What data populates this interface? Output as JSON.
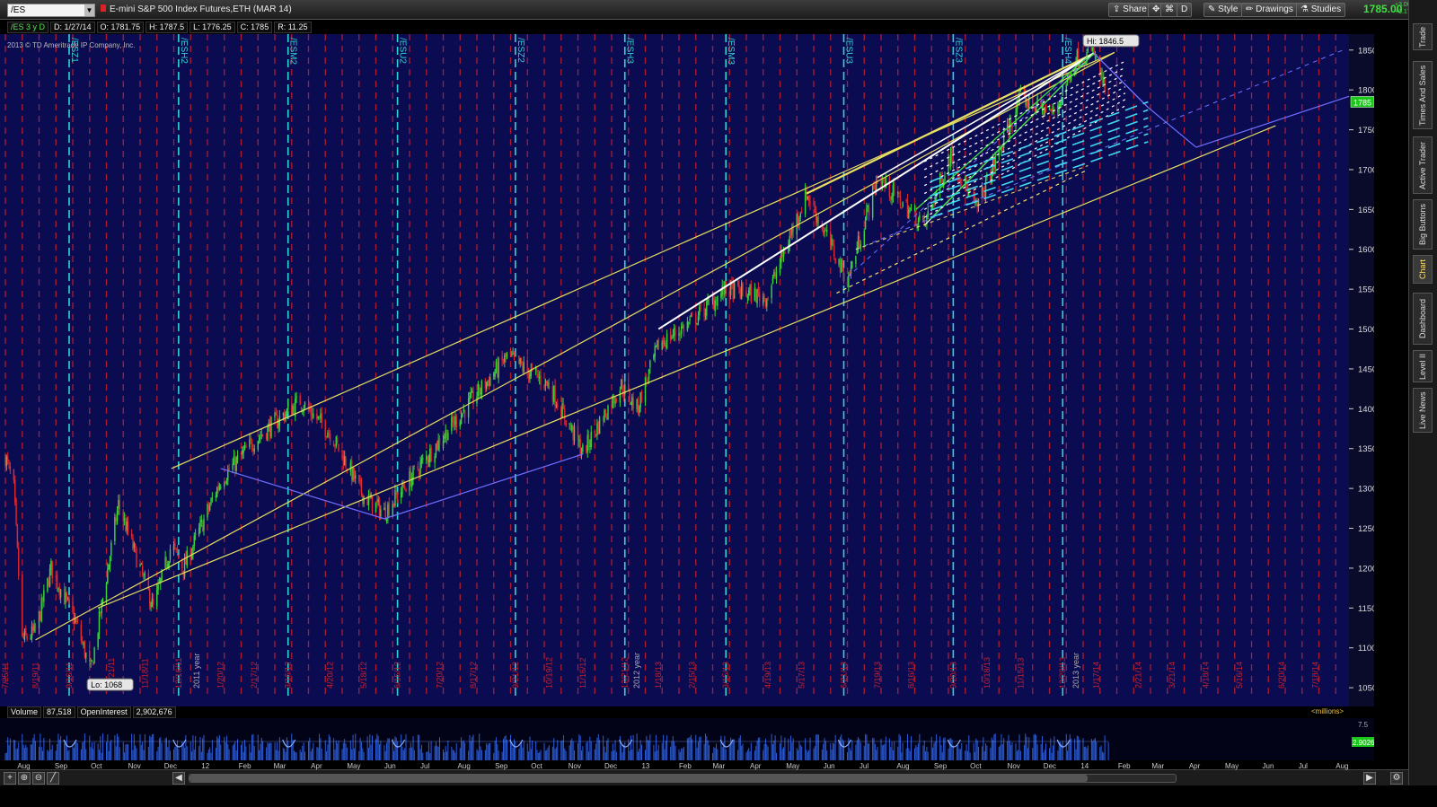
{
  "toolbar": {
    "symbol": "/ES",
    "description": "E-mini S&P 500 Index Futures,ETH (MAR 14)",
    "share_label": "Share",
    "style_label": "Style",
    "drawings_label": "Drawings",
    "studies_label": "Studies",
    "d_label": "D",
    "last_price": "1785.00",
    "change_up": "+3.00",
    "change_pct": "+0.17%"
  },
  "sidebar": {
    "tabs": [
      "Trade",
      "Times And Sales",
      "Active Trader",
      "Big Buttons",
      "Chart",
      "Dashboard",
      "Level II",
      "Live News"
    ],
    "active": "Chart"
  },
  "infobar": {
    "sym": "/ES 3 y D",
    "date": "D: 1/27/14",
    "open": "O: 1781.75",
    "high": "H: 1787.5",
    "low": "L: 1776.25",
    "close": "C: 1785",
    "range": "R: 11.25"
  },
  "copyright": "2013 © TD Ameritrade IP Company, Inc.",
  "volume_header": {
    "vol_label": "Volume",
    "vol_value": "87,518",
    "oi_label": "OpenInterest",
    "oi_value": "2,902,676",
    "units": "<millions>"
  },
  "colors": {
    "background": "#0b0b52",
    "up": "#3ad63a",
    "down": "#e0282f",
    "channel": "#e8e060",
    "trend": "#7070ff",
    "white_line": "#ffffff",
    "cyan": "#40d8f0",
    "expiry_line": "#31d4d4",
    "red_grid": "#c8202c",
    "price_label_bg": "#19c819"
  },
  "icons": [
    "plus-icon",
    "zoom-in-icon",
    "zoom-out-icon",
    "pen-icon",
    "arrow-left-icon",
    "arrow-right-icon",
    "pencil-icon",
    "gear-icon"
  ],
  "chart_data": {
    "type": "candlestick",
    "title": "/ES 3 y D",
    "ylim": [
      1040,
      1870
    ],
    "y_ticks": [
      1050,
      1100,
      1150,
      1200,
      1250,
      1300,
      1350,
      1400,
      1450,
      1500,
      1550,
      1600,
      1650,
      1700,
      1750,
      1800,
      1850
    ],
    "last_price_label": "1785",
    "hi_label": "Hi: 1846.5",
    "lo_label": "Lo: 1068",
    "x_month_labels": [
      "Aug",
      "Sep",
      "Oct",
      "Nov",
      "Dec",
      "12",
      "Feb",
      "Mar",
      "Apr",
      "May",
      "Jun",
      "Jul",
      "Aug",
      "Sep",
      "Oct",
      "Nov",
      "Dec",
      "13",
      "Feb",
      "Mar",
      "Apr",
      "May",
      "Jun",
      "Jul",
      "Aug",
      "Sep",
      "Oct",
      "Nov",
      "Dec",
      "14",
      "Feb",
      "Mar",
      "Apr",
      "May",
      "Jun",
      "Jul",
      "Aug"
    ],
    "expiry_labels": [
      "/ESZ1",
      "/ESH2",
      "/ESM2",
      "/ESU2",
      "/ESZ2",
      "/ESH3",
      "/ESM3",
      "/ESU3",
      "/ESZ3",
      "/ESH4"
    ],
    "date_labels": [
      "7/25/11",
      "8/19/11",
      "9/16/11",
      "10/21/11",
      "11/18/11",
      "12/16/11",
      "2011 year",
      "1/20/12",
      "2/17/12",
      "3/16/12",
      "4/20/12",
      "5/18/12",
      "6/15/12",
      "7/20/12",
      "8/17/12",
      "9/21/12",
      "10/19/12",
      "11/16/12",
      "12/21/12",
      "2012 year",
      "1/18/13",
      "2/15/13",
      "3/15/13",
      "4/19/13",
      "5/17/13",
      "6/21/13",
      "7/19/13",
      "8/16/13",
      "9/20/13",
      "10/18/13",
      "11/15/13",
      "12/20/13",
      "2013 year",
      "1/17/14",
      "2/21/14",
      "3/21/14",
      "4/18/14",
      "5/16/14",
      "6/20/14",
      "7/18/14"
    ],
    "price_path": [
      [
        "2011-07-25",
        1340
      ],
      [
        "2011-08-01",
        1300
      ],
      [
        "2011-08-08",
        1110
      ],
      [
        "2011-08-19",
        1120
      ],
      [
        "2011-09-01",
        1200
      ],
      [
        "2011-09-22",
        1130
      ],
      [
        "2011-10-04",
        1070
      ],
      [
        "2011-10-27",
        1280
      ],
      [
        "2011-11-25",
        1150
      ],
      [
        "2011-12-10",
        1230
      ],
      [
        "2011-12-20",
        1200
      ],
      [
        "2012-01-20",
        1310
      ],
      [
        "2012-02-17",
        1360
      ],
      [
        "2012-03-26",
        1410
      ],
      [
        "2012-04-20",
        1370
      ],
      [
        "2012-05-18",
        1290
      ],
      [
        "2012-06-04",
        1270
      ],
      [
        "2012-07-20",
        1360
      ],
      [
        "2012-09-14",
        1465
      ],
      [
        "2012-10-19",
        1430
      ],
      [
        "2012-11-16",
        1345
      ],
      [
        "2012-12-18",
        1430
      ],
      [
        "2012-12-31",
        1400
      ],
      [
        "2013-01-18",
        1480
      ],
      [
        "2013-02-15",
        1510
      ],
      [
        "2013-03-15",
        1550
      ],
      [
        "2013-04-18",
        1540
      ],
      [
        "2013-05-21",
        1670
      ],
      [
        "2013-06-24",
        1560
      ],
      [
        "2013-07-19",
        1690
      ],
      [
        "2013-08-27",
        1630
      ],
      [
        "2013-09-18",
        1720
      ],
      [
        "2013-10-09",
        1650
      ],
      [
        "2013-11-15",
        1790
      ],
      [
        "2013-12-13",
        1770
      ],
      [
        "2013-12-31",
        1840
      ],
      [
        "2014-01-15",
        1846.5
      ],
      [
        "2014-01-27",
        1785
      ]
    ],
    "volume": {
      "label": "Volume",
      "last": "87,518",
      "open_interest": "2,902,676",
      "oi_last_label": "2.90268",
      "oi_axis_label": "7.5"
    }
  }
}
